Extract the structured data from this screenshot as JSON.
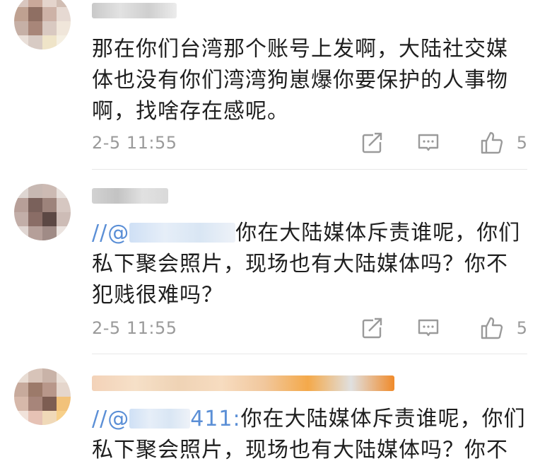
{
  "comments": [
    {
      "text": "那在你们台湾那个账号上发啊，大陆社交媒体也没有你们湾湾狗崽爆你要保护的人事物啊，找啥存在感呢。",
      "mention": "",
      "time": "2-5 11:55",
      "likes": "5"
    },
    {
      "mention": "//@",
      "text": "你在大陆媒体斥责谁呢，你们私下聚会照片，现场也有大陆媒体吗？你不犯贱很难吗？",
      "time": "2-5 11:55",
      "likes": "5"
    },
    {
      "mention": "//@",
      "mention_suffix": "411:",
      "text": "你在大陆媒体斥责谁呢，你们私下聚会照片，现场也有大陆媒体吗？你不",
      "time": "",
      "likes": ""
    }
  ],
  "icons": {
    "share": "share-icon",
    "comment": "comment-icon",
    "like": "thumbs-up-icon"
  },
  "colors": {
    "text": "#1f1f1f",
    "meta": "#9a9a9a",
    "mention": "#5b8fd6"
  }
}
